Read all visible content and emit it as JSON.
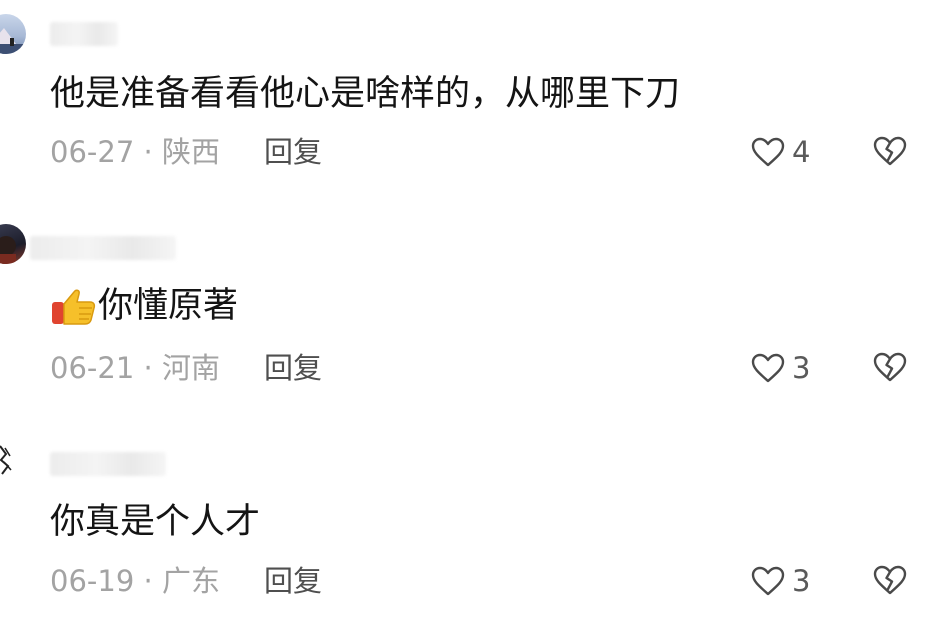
{
  "comments": [
    {
      "text": "他是准备看看他心是啥样的，从哪里下刀",
      "date": "06-27",
      "separator": "·",
      "location": "陕西",
      "reply_label": "回复",
      "likes": "4",
      "has_thumb_emoji": false
    },
    {
      "text": "你懂原著",
      "date": "06-21",
      "separator": "·",
      "location": "河南",
      "reply_label": "回复",
      "likes": "3",
      "has_thumb_emoji": true
    },
    {
      "text": "你真是个人才",
      "date": "06-19",
      "separator": "·",
      "location": "广东",
      "reply_label": "回复",
      "likes": "3",
      "has_thumb_emoji": false
    }
  ],
  "icons": {
    "like": "heart-outline-icon",
    "dislike": "broken-heart-icon",
    "emoji": "thumbs-up-emoji"
  },
  "colors": {
    "text": "#141414",
    "meta": "#a3a3a3",
    "reply": "#4f4f4f",
    "icon": "#4a4a4a"
  }
}
